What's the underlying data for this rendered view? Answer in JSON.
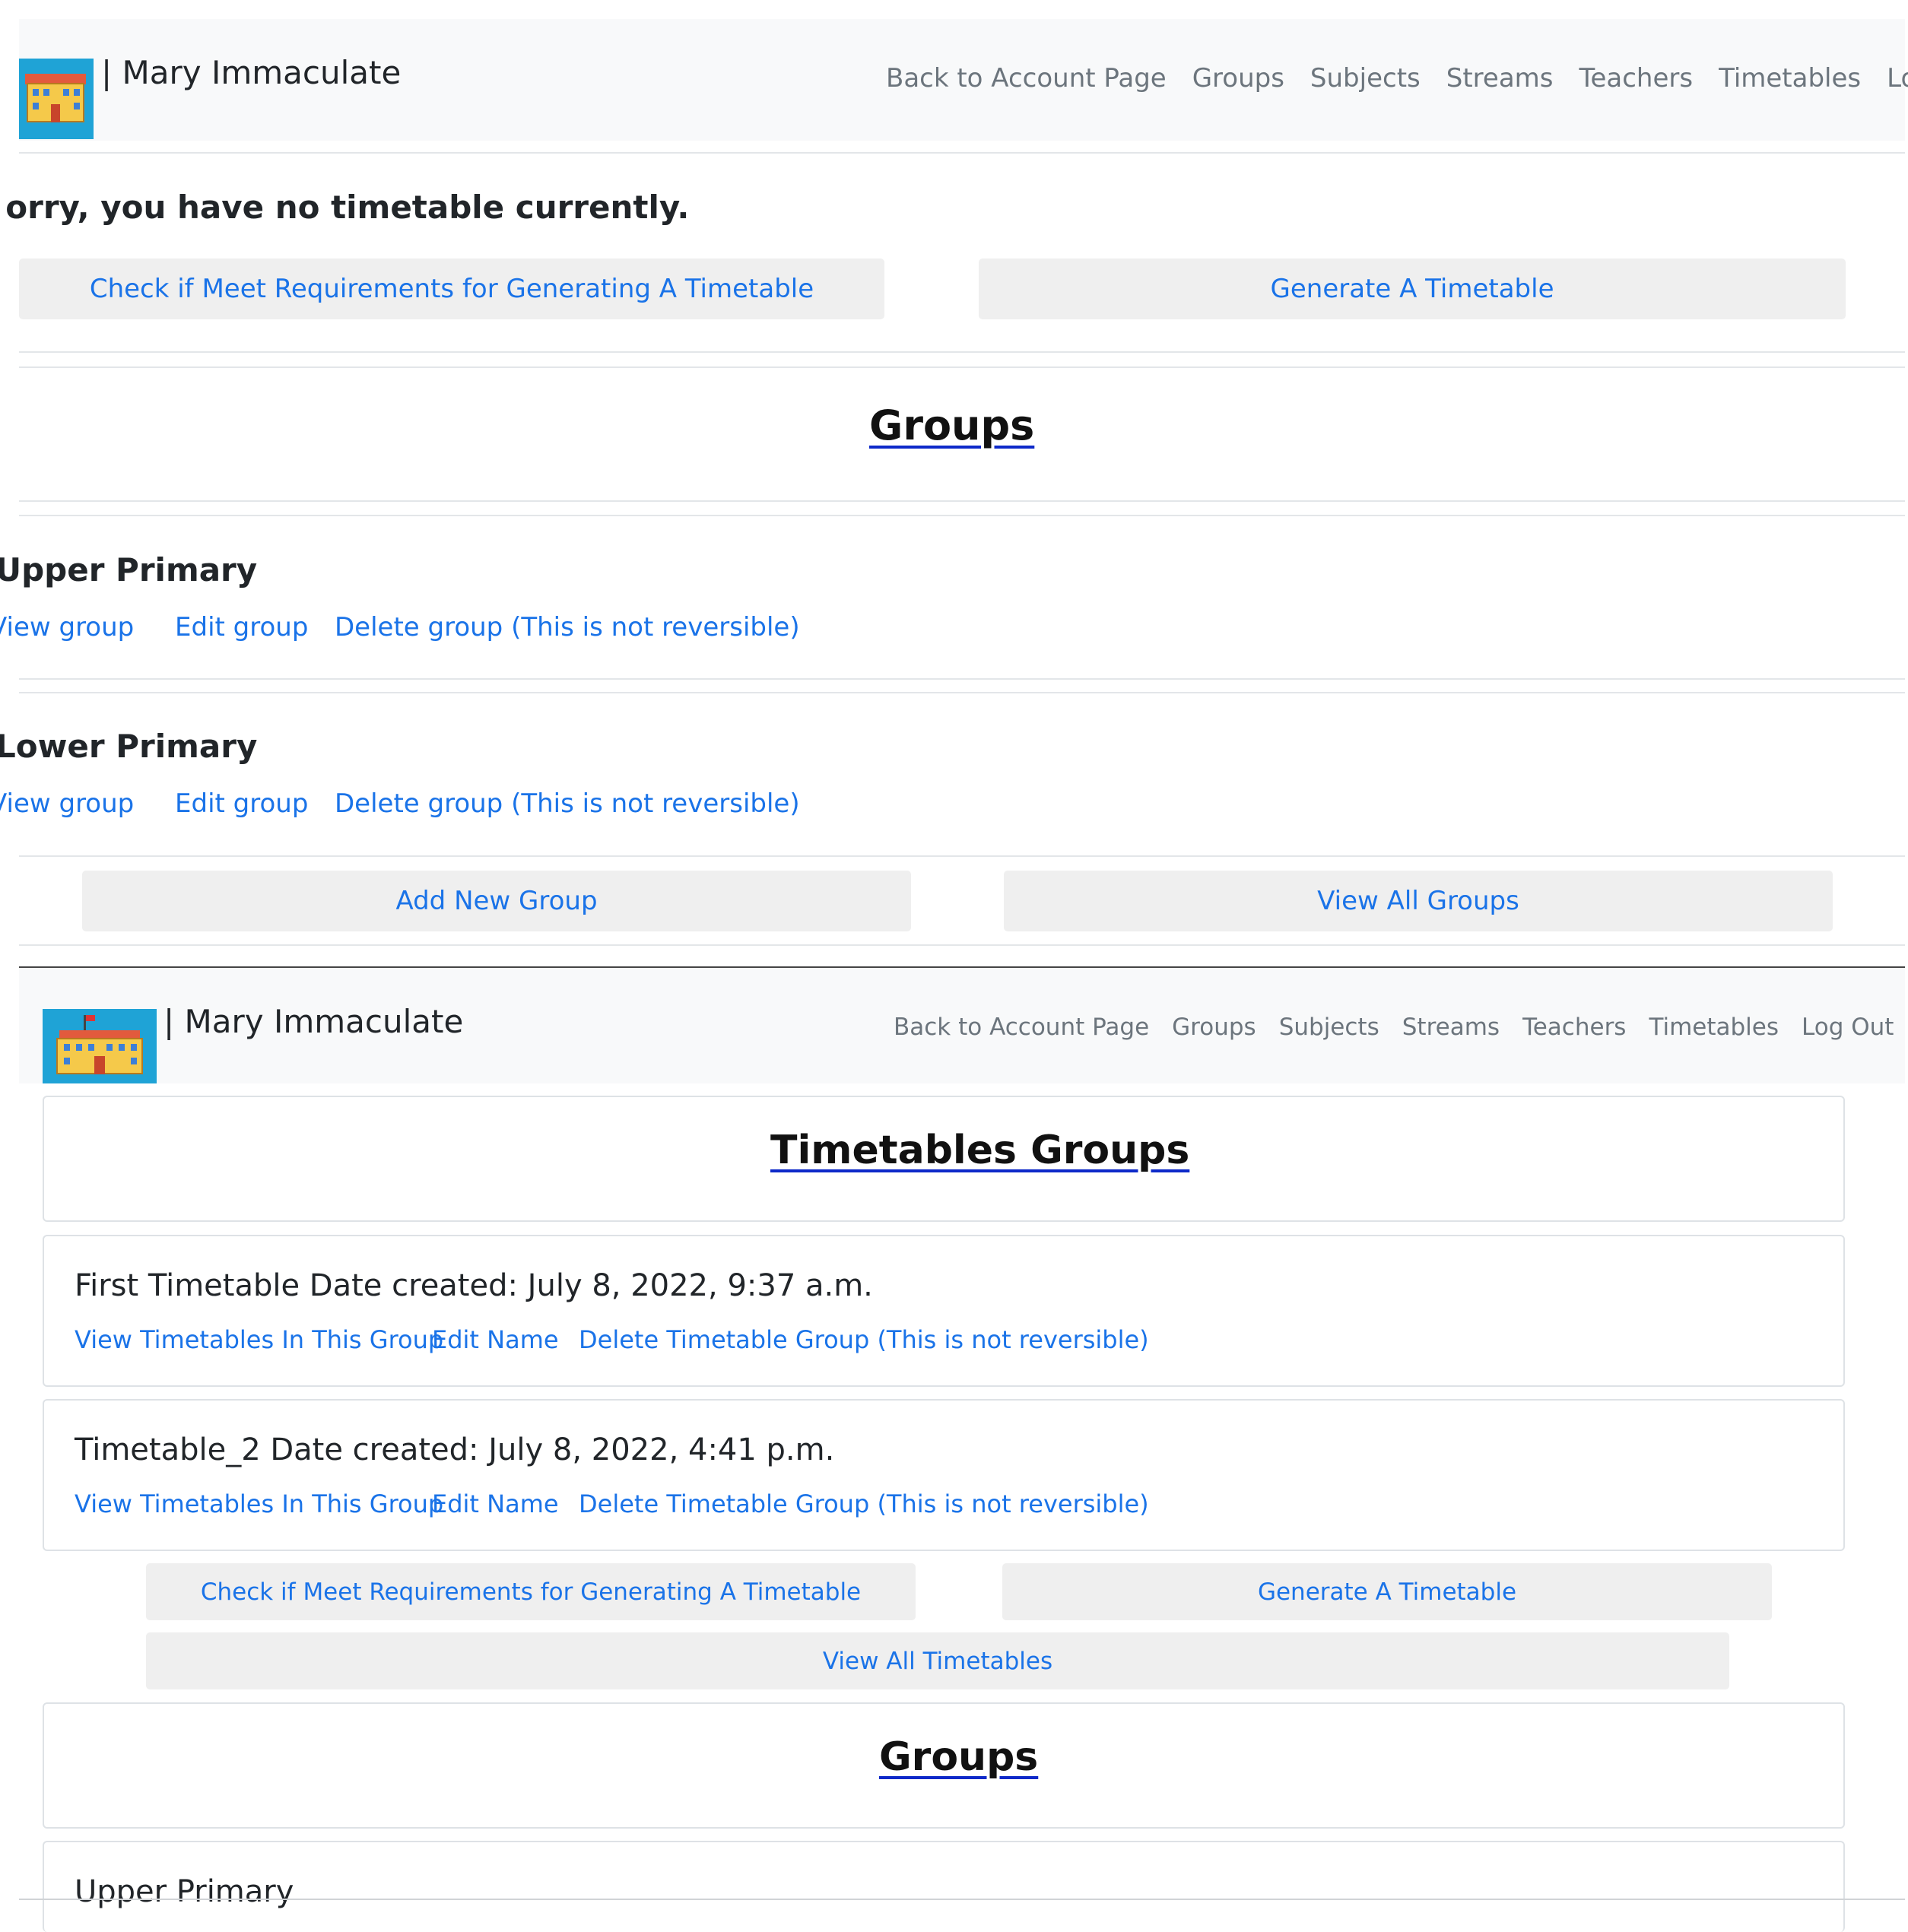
{
  "brand": {
    "name": "| Mary Immaculate"
  },
  "nav": {
    "items": [
      "Back to Account Page",
      "Groups",
      "Subjects",
      "Streams",
      "Teachers",
      "Timetables",
      "Log Out"
    ]
  },
  "top_page": {
    "no_timetable_msg": "Sorry, you have no timetable currently.",
    "check_btn": "Check if Meet Requirements for Generating A Timetable",
    "generate_btn": "Generate A Timetable",
    "groups_heading": "Groups",
    "groups": [
      {
        "name": "Upper Primary",
        "view": "View group",
        "edit": "Edit group",
        "delete": "Delete group (This is not reversible)"
      },
      {
        "name": "Lower Primary",
        "view": "View group",
        "edit": "Edit group",
        "delete": "Delete group (This is not reversible)"
      }
    ],
    "add_group_btn": "Add New Group",
    "view_all_groups_btn": "View All Groups"
  },
  "bottom_page": {
    "timetables_heading": "Timetables Groups",
    "timetable_groups": [
      {
        "title": "First Timetable Date created: July 8, 2022, 9:37 a.m.",
        "view": "View Timetables In This Group",
        "edit": "Edit Name",
        "delete": "Delete Timetable Group (This is not reversible)"
      },
      {
        "title": "Timetable_2 Date created: July 8, 2022, 4:41 p.m.",
        "view": "View Timetables In This Group",
        "edit": "Edit Name",
        "delete": "Delete Timetable Group (This is not reversible)"
      }
    ],
    "check_btn": "Check if Meet Requirements for Generating A Timetable",
    "generate_btn": "Generate A Timetable",
    "view_all_timetables_btn": "View All Timetables",
    "groups_heading": "Groups",
    "first_group_name": "Upper Primary"
  },
  "colors": {
    "link": "#1a73e8",
    "navbar_bg": "#f8f9fa",
    "button_bg": "#efefef",
    "heading_underline": "#0d29c9"
  }
}
